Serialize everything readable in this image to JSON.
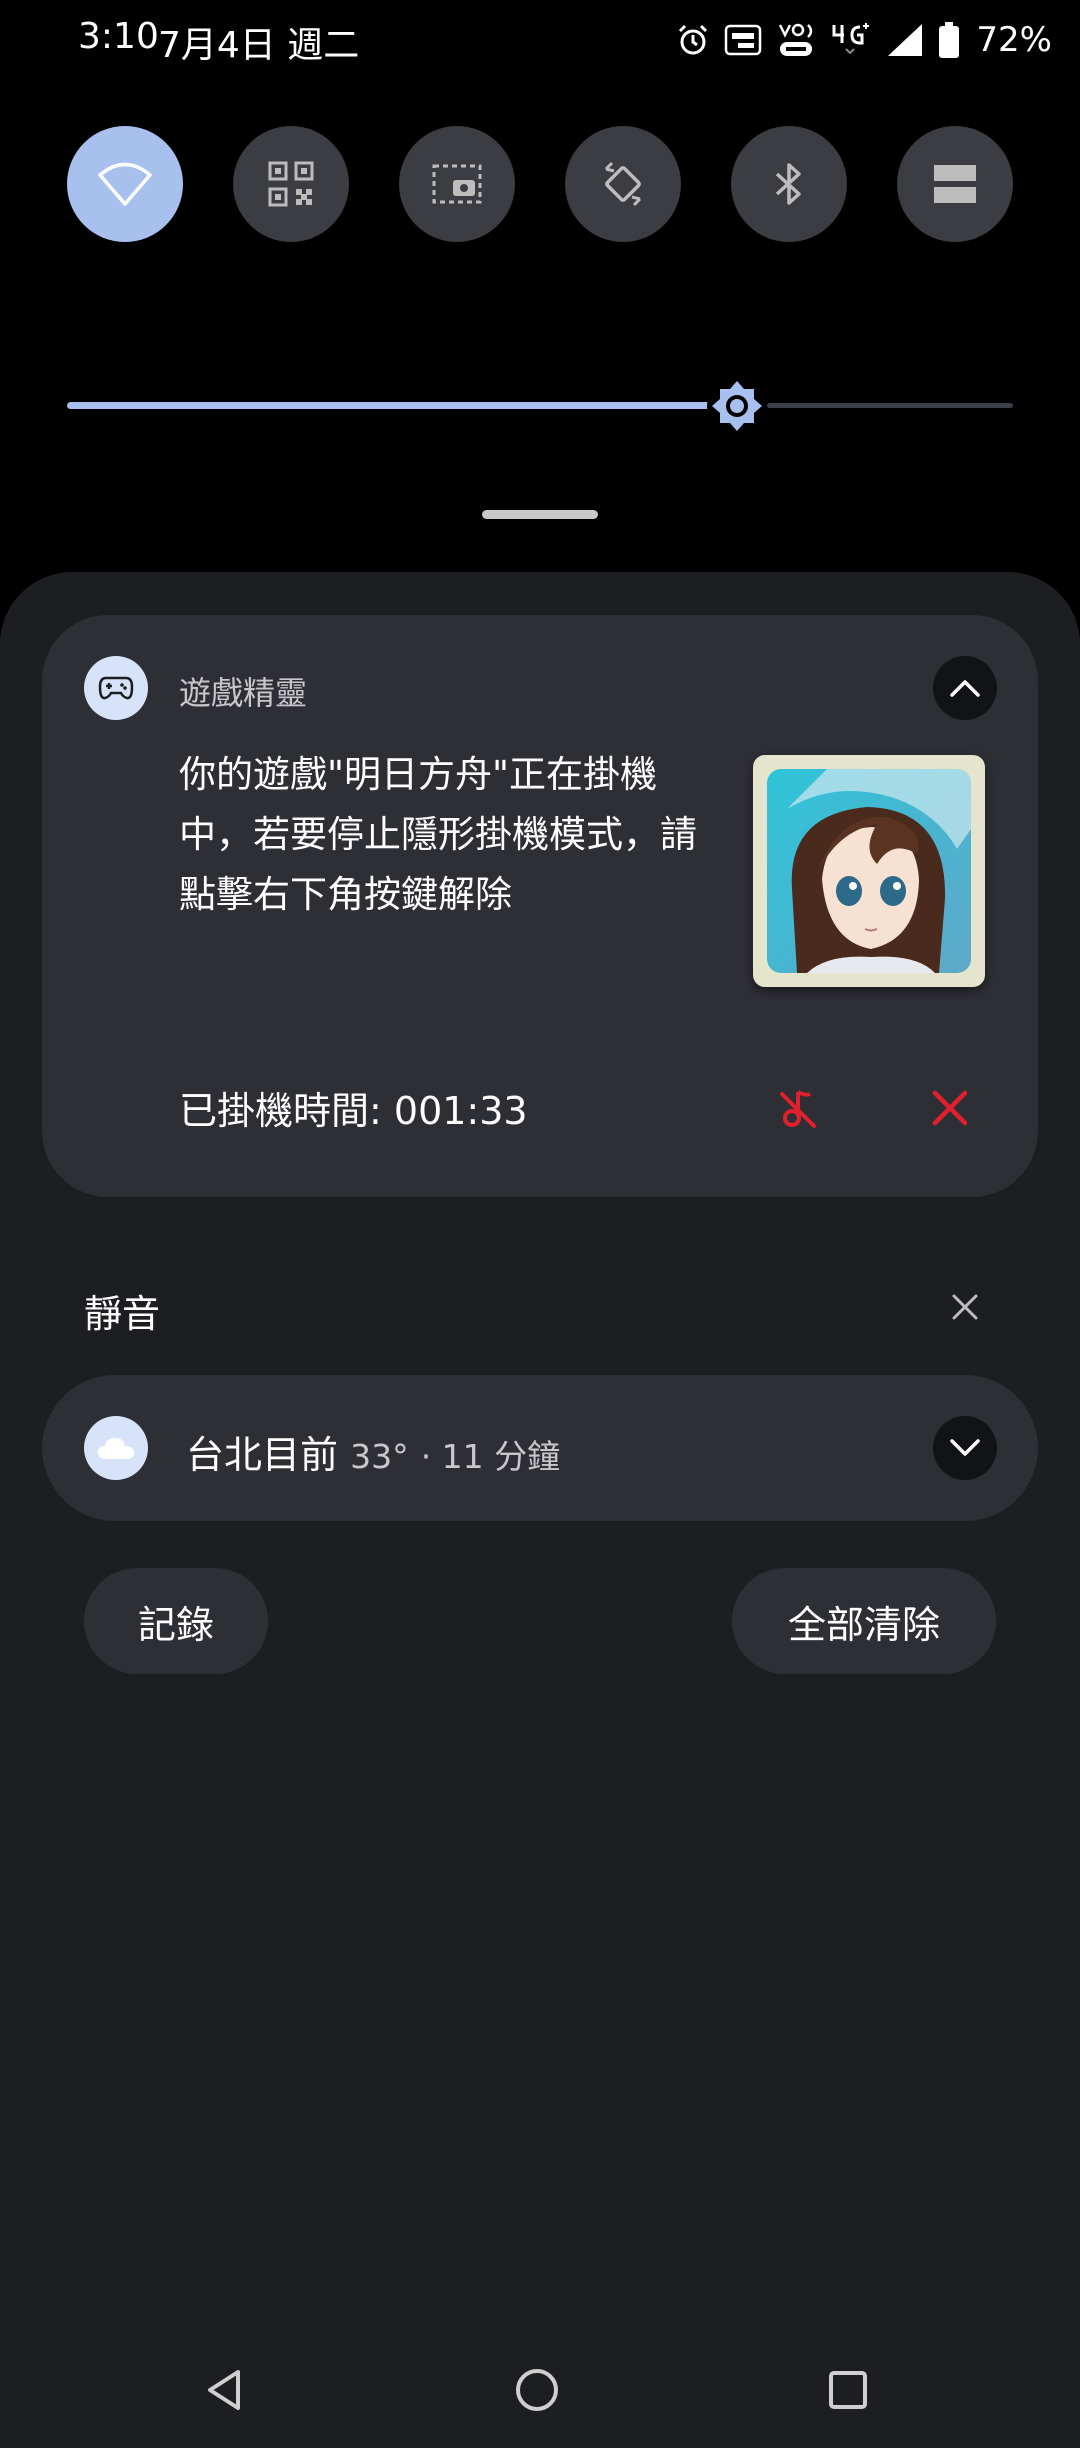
{
  "status_bar": {
    "time": "3:10",
    "date": "7月4日 週二",
    "network": "4G",
    "battery_percent": "72%"
  },
  "quick_settings": {
    "tiles": [
      {
        "icon": "wifi-icon",
        "active": true
      },
      {
        "icon": "qr-code-icon",
        "active": false
      },
      {
        "icon": "screen-record-icon",
        "active": false
      },
      {
        "icon": "auto-rotate-icon",
        "active": false
      },
      {
        "icon": "bluetooth-icon",
        "active": false
      },
      {
        "icon": "split-screen-icon",
        "active": false
      }
    ],
    "brightness_level": 0.7
  },
  "game_notification": {
    "app_name": "遊戲精靈",
    "message": "你的遊戲\"明日方舟\"正在掛機中，若要停止隱形掛機模式，請點擊右下角按鍵解除",
    "idle_label": "已掛機時間:",
    "idle_value": "001:33"
  },
  "silent_section": {
    "title": "靜音"
  },
  "weather_notification": {
    "location_text": "台北目前",
    "temperature": "33°",
    "meta": "· 11 分鐘"
  },
  "actions": {
    "history_label": "記錄",
    "clear_all_label": "全部清除"
  },
  "colors": {
    "accent": "#a7c0ee",
    "card_bg": "#2e2f35",
    "panel_bg": "#1d1e21",
    "danger": "#e0202c"
  }
}
